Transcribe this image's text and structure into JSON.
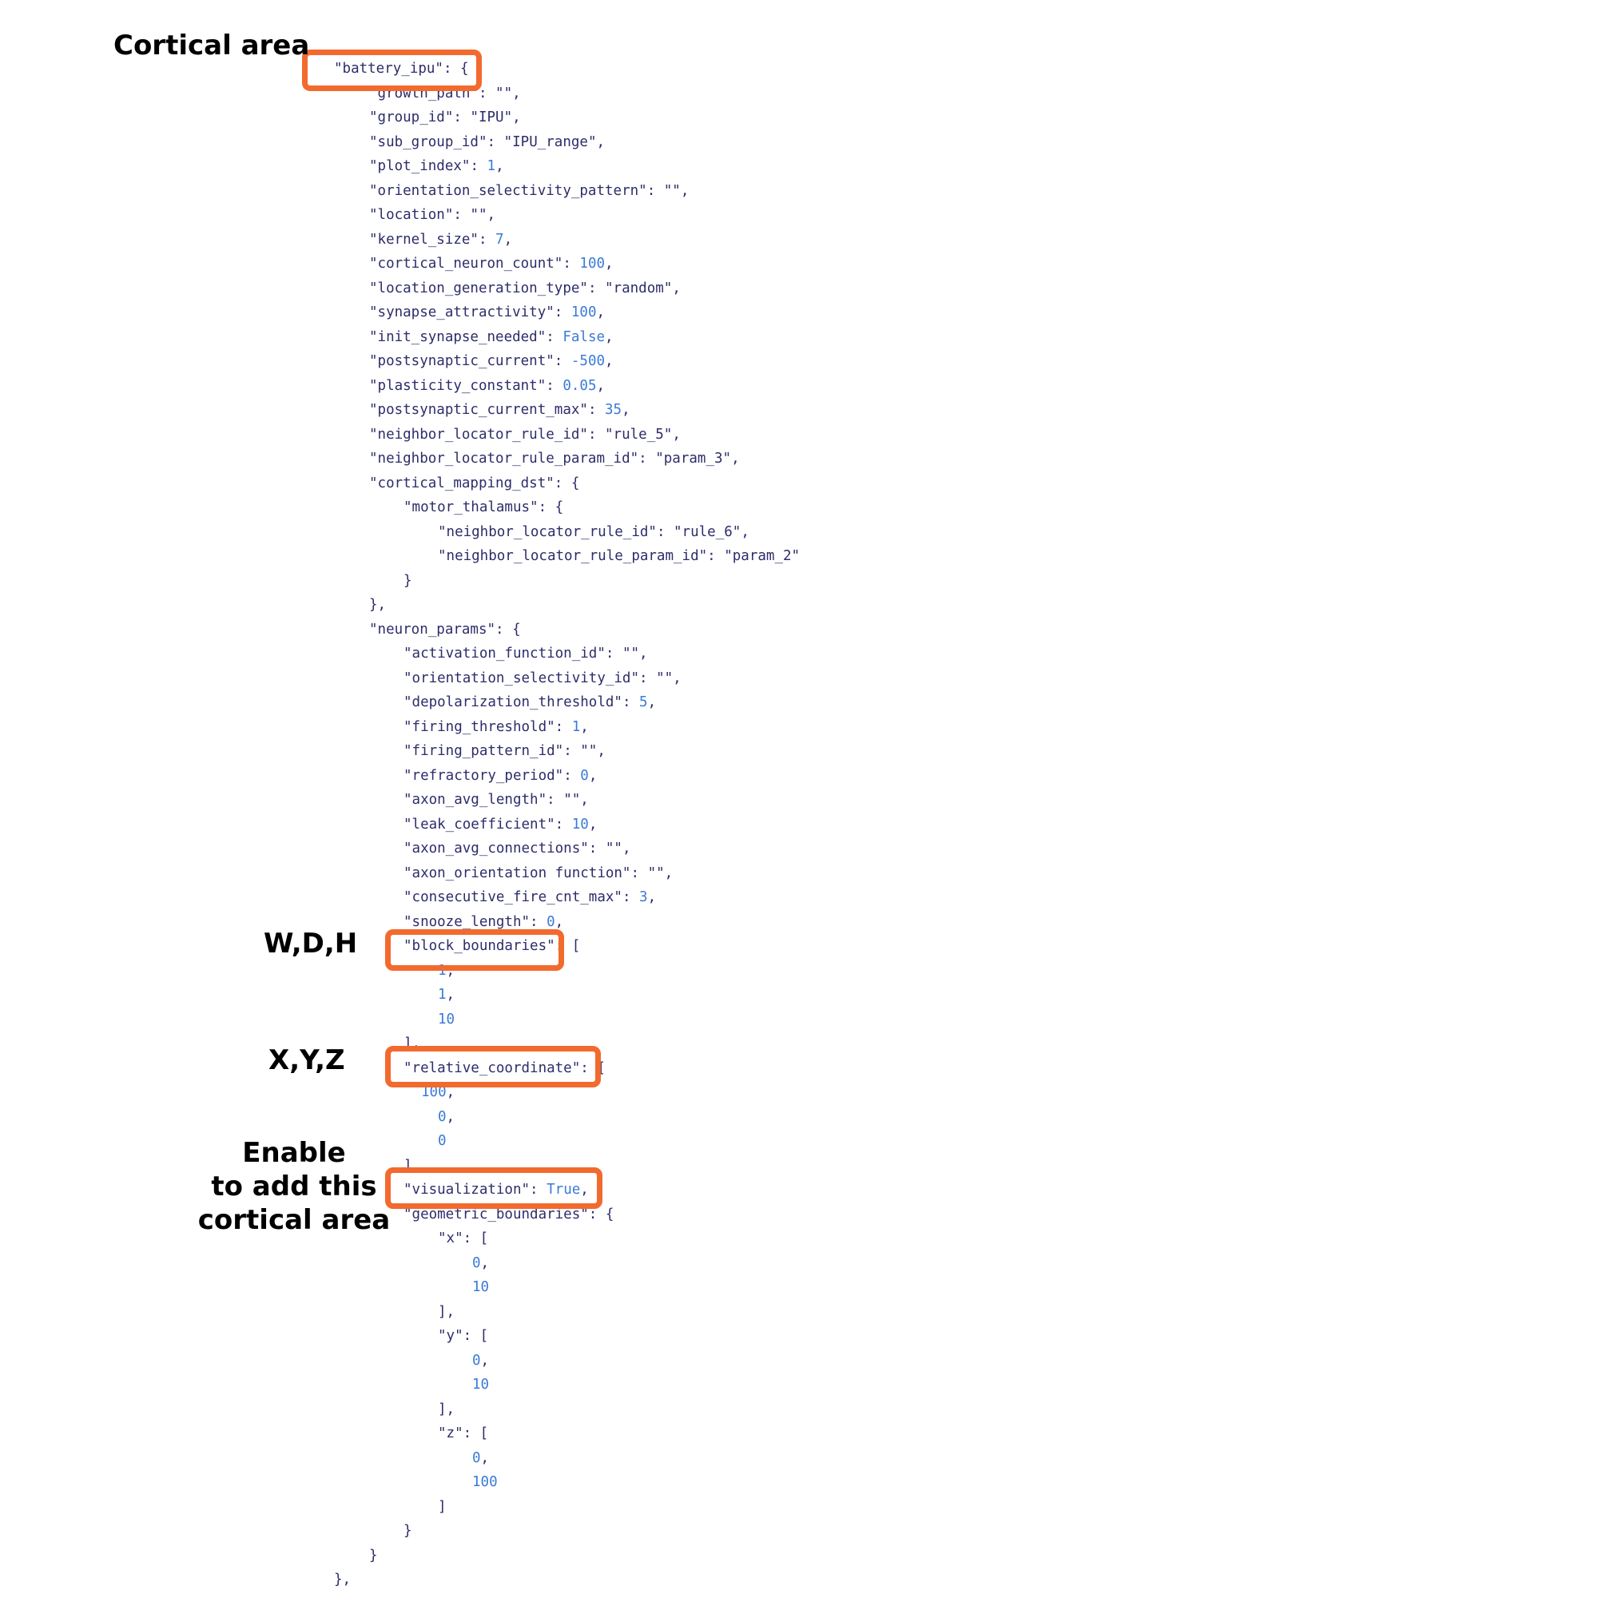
{
  "annotations": {
    "cortical_area": "Cortical area",
    "wdh": "W,D,H",
    "xyz": "X,Y,Z",
    "enable_line1": "Enable",
    "enable_line2": "to add this",
    "enable_line3": "cortical area"
  },
  "highlight_color": "#f26a2e",
  "code_lines": [
    "\"battery_ipu\": {",
    "\"growth_path\": \"\",",
    "\"group_id\": \"IPU\",",
    "\"sub_group_id\": \"IPU_range\",",
    "\"plot_index\": 1,",
    "\"orientation_selectivity_pattern\": \"\",",
    "\"location\": \"\",",
    "\"kernel_size\": 7,",
    "\"cortical_neuron_count\": 100,",
    "\"location_generation_type\": \"random\",",
    "\"synapse_attractivity\": 100,",
    "\"init_synapse_needed\": False,",
    "\"postsynaptic_current\": -500,",
    "\"plasticity_constant\": 0.05,",
    "\"postsynaptic_current_max\": 35,",
    "\"neighbor_locator_rule_id\": \"rule_5\",",
    "\"neighbor_locator_rule_param_id\": \"param_3\",",
    "\"cortical_mapping_dst\": {",
    "\"motor_thalamus\": {",
    "\"neighbor_locator_rule_id\": \"rule_6\",",
    "\"neighbor_locator_rule_param_id\": \"param_2\"",
    "}",
    "},",
    "\"neuron_params\": {",
    "\"activation_function_id\": \"\",",
    "\"orientation_selectivity_id\": \"\",",
    "\"depolarization_threshold\": 5,",
    "\"firing_threshold\": 1,",
    "\"firing_pattern_id\": \"\",",
    "\"refractory_period\": 0,",
    "\"axon_avg_length\": \"\",",
    "\"leak_coefficient\": 10,",
    "\"axon_avg_connections\": \"\",",
    "\"axon_orientation function\": \"\",",
    "\"consecutive_fire_cnt_max\": 3,",
    "\"snooze_length\": 0,",
    "\"block_boundaries\": [",
    "1,",
    "1,",
    "10",
    "],",
    "\"relative_coordinate\": [",
    "100,",
    "0,",
    "0",
    "],",
    "\"visualization\": True,",
    "\"geometric_boundaries\": {",
    "\"x\": [",
    "0,",
    "10",
    "],",
    "\"y\": [",
    "0,",
    "10",
    "],",
    "\"z\": [",
    "0,",
    "100",
    "]",
    "}",
    "}",
    "},"
  ]
}
